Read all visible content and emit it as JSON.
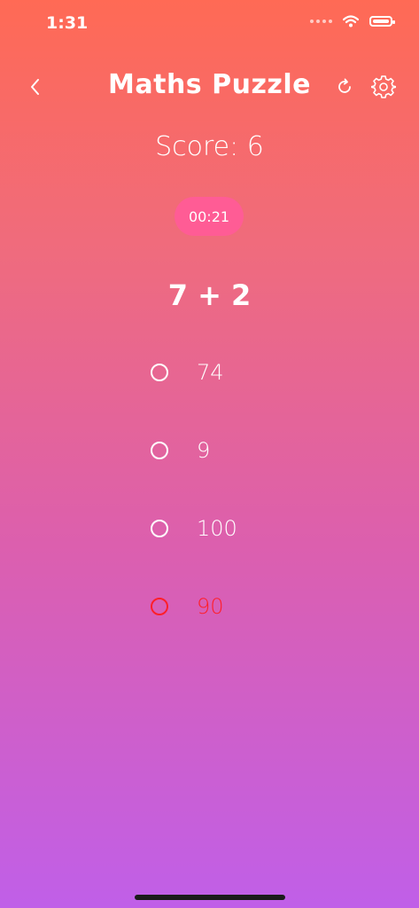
{
  "status_bar": {
    "time": "1:31",
    "signal_icon": "signal-dots-icon",
    "wifi_icon": "wifi-icon",
    "battery_icon": "battery-icon"
  },
  "header": {
    "title": "Maths Puzzle",
    "back_icon": "chevron-left-icon",
    "refresh_icon": "refresh-icon",
    "settings_icon": "gear-icon"
  },
  "score_text": "Score: 6",
  "timer": "00:21",
  "question": "7 + 2",
  "options": [
    {
      "label": "74",
      "state": "default"
    },
    {
      "label": "9",
      "state": "default"
    },
    {
      "label": "100",
      "state": "default"
    },
    {
      "label": "90",
      "state": "wrong"
    }
  ],
  "colors": {
    "gradient_top": "#ff6a55",
    "gradient_bottom": "#c05fe8",
    "timer_background": "#ff5c95",
    "wrong_answer": "#ff1f2a",
    "text": "#ffffff"
  }
}
